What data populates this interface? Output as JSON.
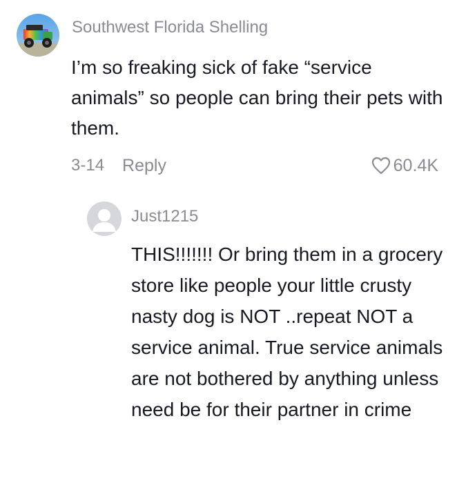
{
  "comment": {
    "username": "Southwest Florida Shelling",
    "text": "I’m so freaking sick of fake “service animals” so people can bring their pets with them.",
    "date": "3-14",
    "reply_label": "Reply",
    "likes": "60.4K"
  },
  "reply": {
    "username": "Just1215",
    "text": "THIS!!!!!!! Or bring them in a grocery store like people your little crusty nasty dog is NOT ..repeat NOT a service animal. True service animals are not bothered by anything unless need be for their partner in crime"
  },
  "icons": {
    "like": "heart-outline-icon",
    "default_avatar": "default-avatar-icon"
  },
  "colors": {
    "primary_text": "#161823",
    "secondary_text": "#8a8b91",
    "default_avatar_bg": "#d6d7da"
  }
}
